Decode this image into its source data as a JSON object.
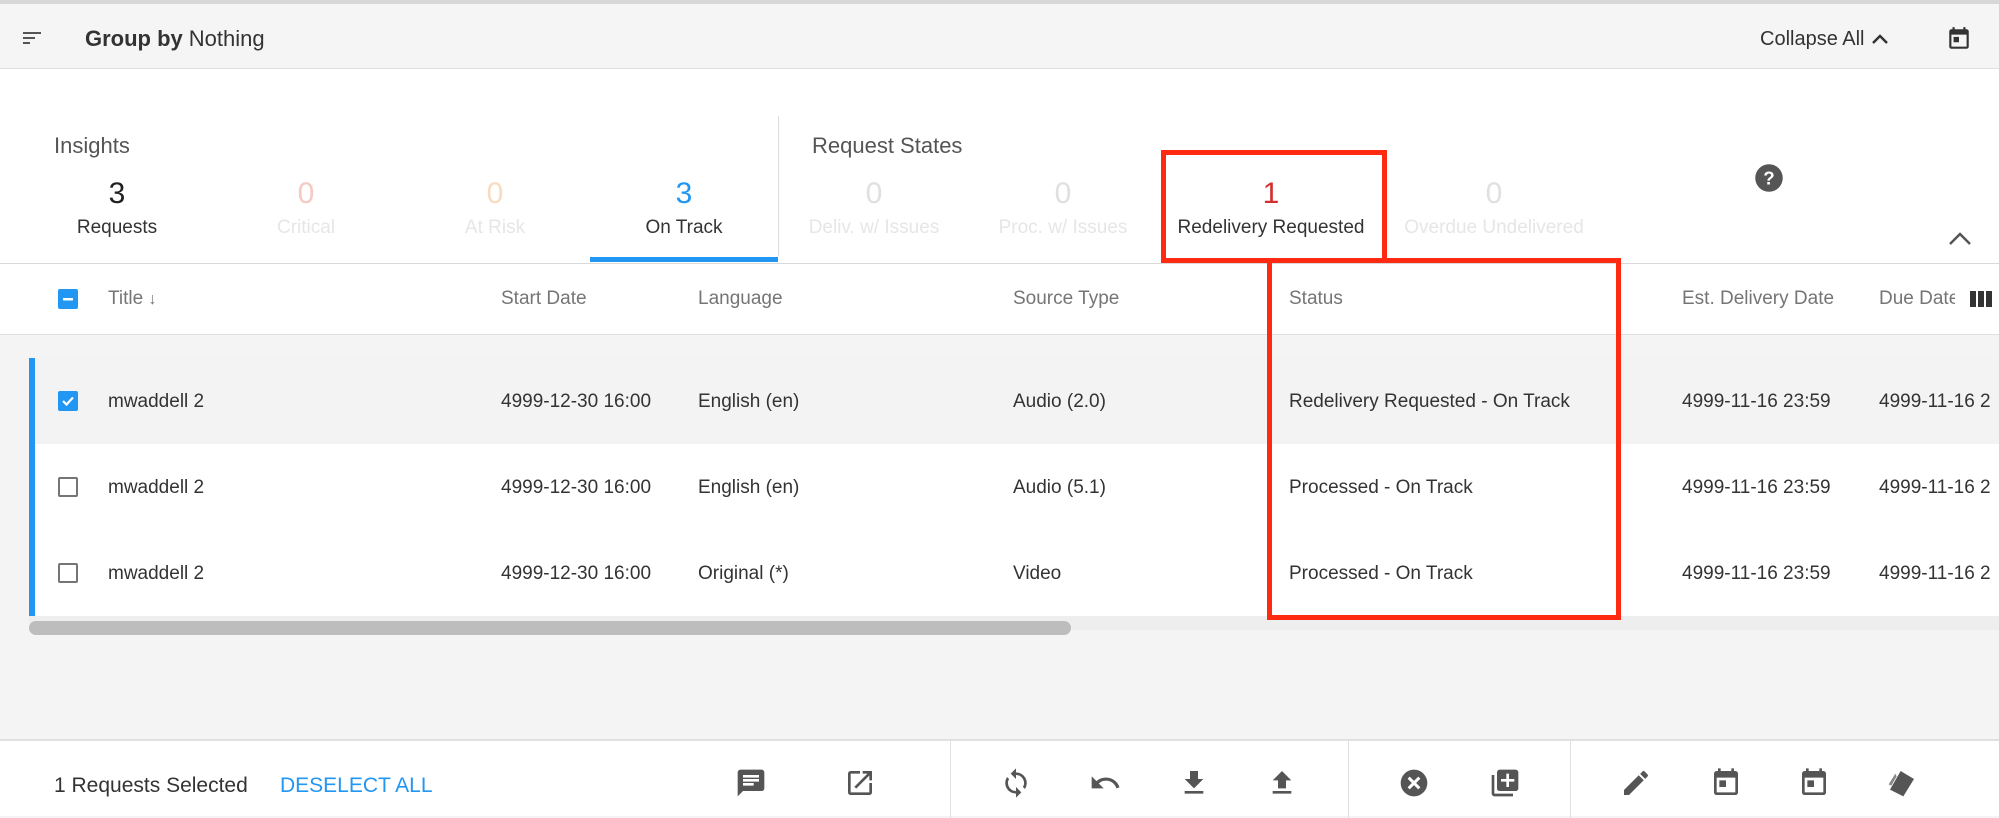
{
  "toolbar": {
    "groupby_label": "Group by",
    "groupby_value": "Nothing",
    "collapse_all": "Collapse All"
  },
  "insights": {
    "title": "Insights",
    "metrics": [
      {
        "value": "3",
        "label": "Requests",
        "color": "#212121"
      },
      {
        "value": "0",
        "label": "Critical",
        "color": "#f6c9c3"
      },
      {
        "value": "0",
        "label": "At Risk",
        "color": "#f8dcc0"
      },
      {
        "value": "3",
        "label": "On Track",
        "color": "#2196f3"
      }
    ]
  },
  "request_states": {
    "title": "Request States",
    "metrics": [
      {
        "value": "0",
        "label": "Deliv. w/ Issues"
      },
      {
        "value": "0",
        "label": "Proc. w/ Issues"
      },
      {
        "value": "1",
        "label": "Redelivery Requested"
      },
      {
        "value": "0",
        "label": "Overdue Undelivered"
      }
    ]
  },
  "table": {
    "columns": [
      "Title",
      "Start Date",
      "Language",
      "Source Type",
      "Status",
      "Est. Delivery Date",
      "Due Date"
    ],
    "sort_indicator": "↓",
    "rows": [
      {
        "selected": true,
        "title": "mwaddell 2",
        "start": "4999-12-30 16:00",
        "language": "English (en)",
        "source": "Audio (2.0)",
        "status": "Redelivery Requested - On Track",
        "est": "4999-11-16 23:59",
        "due": "4999-11-16 2"
      },
      {
        "selected": false,
        "title": "mwaddell 2",
        "start": "4999-12-30 16:00",
        "language": "English (en)",
        "source": "Audio (5.1)",
        "status": "Processed - On Track",
        "est": "4999-11-16 23:59",
        "due": "4999-11-16 2"
      },
      {
        "selected": false,
        "title": "mwaddell 2",
        "start": "4999-12-30 16:00",
        "language": "Original (*)",
        "source": "Video",
        "status": "Processed - On Track",
        "est": "4999-11-16 23:59",
        "due": "4999-11-16 2"
      }
    ]
  },
  "footer": {
    "selected_count": "1 Requests Selected",
    "deselect_all": "DESELECT ALL"
  },
  "colors": {
    "accent": "#2196f3",
    "highlight": "#ff2a12",
    "redelivery": "#d32f2f"
  }
}
